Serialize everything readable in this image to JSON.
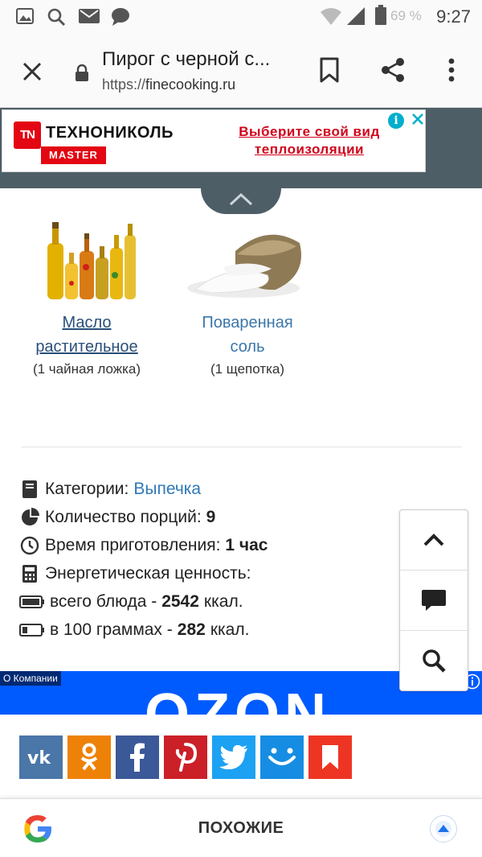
{
  "status_bar": {
    "battery": "69 %",
    "time": "9:27"
  },
  "toolbar": {
    "title": "Пирог с черной с...",
    "url_scheme": "https://",
    "url_host": "finecooking.ru"
  },
  "ad": {
    "logo_text": "TN",
    "brand": "ТЕХНОНИКОЛЬ",
    "badge": "MASTER",
    "cta_line1": "Выберите свой вид",
    "cta_line2": "теплоизоляции",
    "info": "i"
  },
  "ingredients": [
    {
      "name_line1": "Масло",
      "name_line2": "растительное",
      "quantity": "(1 чайная ложка)"
    },
    {
      "name_line1": "Поваренная",
      "name_line2": "соль",
      "quantity": "(1 щепотка)"
    }
  ],
  "recipe_info": {
    "category_label": "Категории:",
    "category_value": "Выпечка",
    "servings_label": "Количество порций:",
    "servings_value": "9",
    "time_label": "Время приготовления:",
    "time_value": "1 час",
    "energy_label": "Энергетическая ценность:",
    "total_label": "всего блюда -",
    "total_value": "2542",
    "per100_label": "в 100 граммах -",
    "per100_value": "282",
    "unit": "ккал."
  },
  "ozon": {
    "label": "О Компании",
    "logo": "OZON"
  },
  "share": {
    "colors": {
      "vk": "#4a76a8",
      "ok": "#ee8208",
      "facebook": "#3b5998",
      "pinterest": "#cb2027",
      "twitter": "#1da1f2",
      "moimir": "#168de2",
      "bookmark": "#ee3524"
    }
  },
  "google_bar": {
    "label": "ПОХОЖИЕ"
  }
}
